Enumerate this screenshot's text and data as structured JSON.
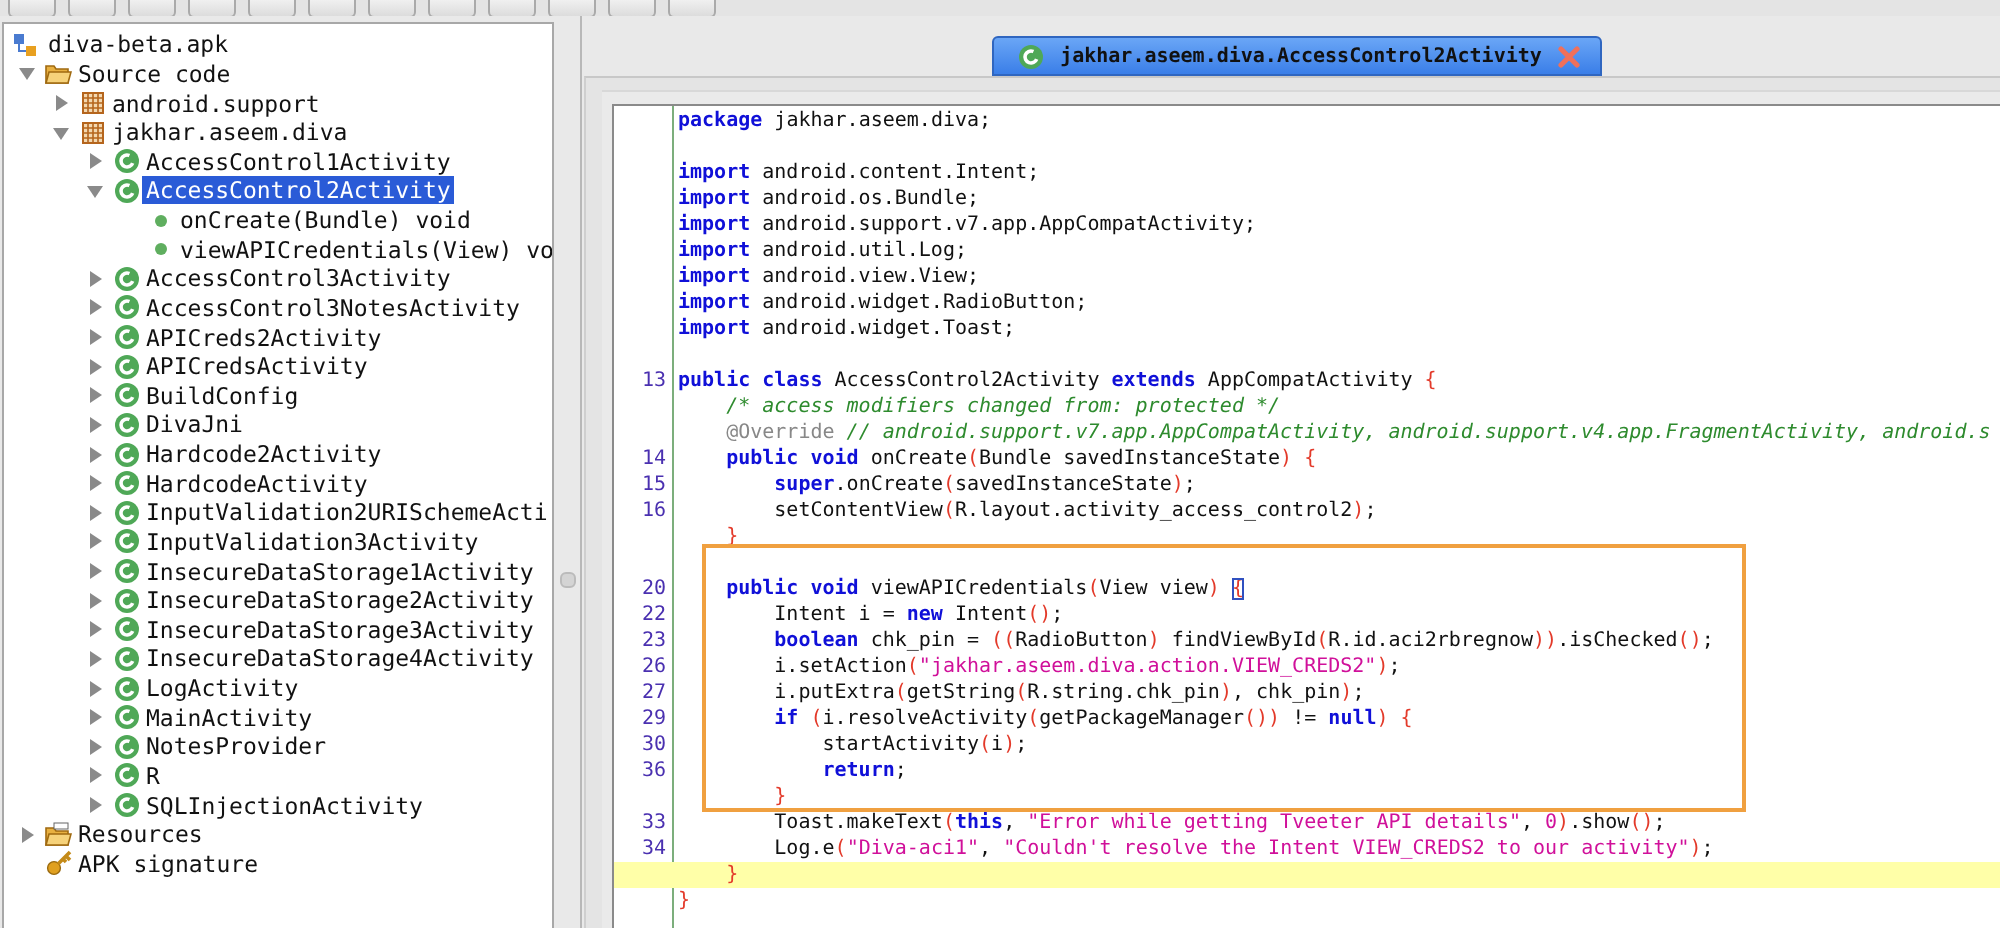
{
  "project": {
    "label": "diva-beta.apk",
    "kind": "apk"
  },
  "tree": [
    {
      "label": "Source code",
      "kind": "folder",
      "expanded": true,
      "selected": false,
      "children": [
        {
          "label": "android.support",
          "kind": "package",
          "expanded": false,
          "selected": false
        },
        {
          "label": "jakhar.aseem.diva",
          "kind": "package",
          "expanded": true,
          "selected": false,
          "children": [
            {
              "label": "AccessControl1Activity",
              "kind": "class",
              "expanded": false,
              "selected": false
            },
            {
              "label": "AccessControl2Activity",
              "kind": "class",
              "expanded": true,
              "selected": true,
              "children": [
                {
                  "label": "onCreate(Bundle) void",
                  "kind": "method",
                  "selected": false
                },
                {
                  "label": "viewAPICredentials(View) vo",
                  "kind": "method",
                  "selected": false
                }
              ]
            },
            {
              "label": "AccessControl3Activity",
              "kind": "class",
              "expanded": false,
              "selected": false
            },
            {
              "label": "AccessControl3NotesActivity",
              "kind": "class",
              "expanded": false,
              "selected": false
            },
            {
              "label": "APICreds2Activity",
              "kind": "class",
              "expanded": false,
              "selected": false
            },
            {
              "label": "APICredsActivity",
              "kind": "class",
              "expanded": false,
              "selected": false
            },
            {
              "label": "BuildConfig",
              "kind": "class",
              "expanded": false,
              "selected": false
            },
            {
              "label": "DivaJni",
              "kind": "class",
              "expanded": false,
              "selected": false
            },
            {
              "label": "Hardcode2Activity",
              "kind": "class",
              "expanded": false,
              "selected": false
            },
            {
              "label": "HardcodeActivity",
              "kind": "class",
              "expanded": false,
              "selected": false
            },
            {
              "label": "InputValidation2URISchemeActi",
              "kind": "class",
              "expanded": false,
              "selected": false
            },
            {
              "label": "InputValidation3Activity",
              "kind": "class",
              "expanded": false,
              "selected": false
            },
            {
              "label": "InsecureDataStorage1Activity",
              "kind": "class",
              "expanded": false,
              "selected": false
            },
            {
              "label": "InsecureDataStorage2Activity",
              "kind": "class",
              "expanded": false,
              "selected": false
            },
            {
              "label": "InsecureDataStorage3Activity",
              "kind": "class",
              "expanded": false,
              "selected": false
            },
            {
              "label": "InsecureDataStorage4Activity",
              "kind": "class",
              "expanded": false,
              "selected": false
            },
            {
              "label": "LogActivity",
              "kind": "class",
              "expanded": false,
              "selected": false
            },
            {
              "label": "MainActivity",
              "kind": "class",
              "expanded": false,
              "selected": false
            },
            {
              "label": "NotesProvider",
              "kind": "class",
              "expanded": false,
              "selected": false
            },
            {
              "label": "R",
              "kind": "class",
              "expanded": false,
              "selected": false
            },
            {
              "label": "SQLInjectionActivity",
              "kind": "class",
              "expanded": false,
              "selected": false
            }
          ]
        }
      ]
    },
    {
      "label": "Resources",
      "kind": "resources",
      "expanded": false,
      "selected": false
    },
    {
      "label": "APK signature",
      "kind": "key",
      "selected": false
    }
  ],
  "editor_tab": {
    "title": "jakhar.aseem.diva.AccessControl2Activity",
    "selected": true
  },
  "code": {
    "lines": [
      {
        "kind": "code",
        "segments": [
          {
            "kind": "keyword",
            "text": "package"
          },
          {
            "kind": "plain",
            "text": " jakhar.aseem.diva;"
          }
        ]
      },
      {
        "kind": "blank"
      },
      {
        "kind": "code",
        "segments": [
          {
            "kind": "keyword",
            "text": "import"
          },
          {
            "kind": "plain",
            "text": " android.content.Intent;"
          }
        ]
      },
      {
        "kind": "code",
        "segments": [
          {
            "kind": "keyword",
            "text": "import"
          },
          {
            "kind": "plain",
            "text": " android.os.Bundle;"
          }
        ]
      },
      {
        "kind": "code",
        "segments": [
          {
            "kind": "keyword",
            "text": "import"
          },
          {
            "kind": "plain",
            "text": " android.support.v7.app.AppCompatActivity;"
          }
        ]
      },
      {
        "kind": "code",
        "segments": [
          {
            "kind": "keyword",
            "text": "import"
          },
          {
            "kind": "plain",
            "text": " android.util.Log;"
          }
        ]
      },
      {
        "kind": "code",
        "segments": [
          {
            "kind": "keyword",
            "text": "import"
          },
          {
            "kind": "plain",
            "text": " android.view.View;"
          }
        ]
      },
      {
        "kind": "code",
        "segments": [
          {
            "kind": "keyword",
            "text": "import"
          },
          {
            "kind": "plain",
            "text": " android.widget.RadioButton;"
          }
        ]
      },
      {
        "kind": "code",
        "segments": [
          {
            "kind": "keyword",
            "text": "import"
          },
          {
            "kind": "plain",
            "text": " android.widget.Toast;"
          }
        ]
      },
      {
        "kind": "blank"
      },
      {
        "kind": "code",
        "number": "13",
        "segments": [
          {
            "kind": "keyword",
            "text": "public class"
          },
          {
            "kind": "plain",
            "text": " AccessControl2Activity "
          },
          {
            "kind": "keyword",
            "text": "extends"
          },
          {
            "kind": "plain",
            "text": " AppCompatActivity "
          },
          {
            "kind": "punct",
            "text": "{"
          }
        ]
      },
      {
        "kind": "code",
        "segments": [
          {
            "kind": "comment",
            "text": "    /* access modifiers changed from: protected */"
          }
        ]
      },
      {
        "kind": "code",
        "segments": [
          {
            "kind": "annotation",
            "text": "    @Override"
          },
          {
            "kind": "comment",
            "text": " // android.support.v7.app.AppCompatActivity, android.support.v4.app.FragmentActivity, android.s"
          }
        ]
      },
      {
        "kind": "code",
        "number": "14",
        "segments": [
          {
            "kind": "keyword",
            "text": "    public void"
          },
          {
            "kind": "plain",
            "text": " onCreate"
          },
          {
            "kind": "punct",
            "text": "("
          },
          {
            "kind": "plain",
            "text": "Bundle savedInstanceState"
          },
          {
            "kind": "punct",
            "text": ") {"
          }
        ]
      },
      {
        "kind": "code",
        "number": "15",
        "segments": [
          {
            "kind": "keyword",
            "text": "        super"
          },
          {
            "kind": "plain",
            "text": ".onCreate"
          },
          {
            "kind": "punct",
            "text": "("
          },
          {
            "kind": "plain",
            "text": "savedInstanceState"
          },
          {
            "kind": "punct",
            "text": ")"
          },
          {
            "kind": "plain",
            "text": ";"
          }
        ]
      },
      {
        "kind": "code",
        "number": "16",
        "segments": [
          {
            "kind": "plain",
            "text": "        setContentView"
          },
          {
            "kind": "punct",
            "text": "("
          },
          {
            "kind": "plain",
            "text": "R.layout.activity_access_control2"
          },
          {
            "kind": "punct",
            "text": ")"
          },
          {
            "kind": "plain",
            "text": ";"
          }
        ]
      },
      {
        "kind": "code",
        "segments": [
          {
            "kind": "punct",
            "text": "    }"
          }
        ]
      },
      {
        "kind": "box",
        "lines": [
          {
            "kind": "blank"
          },
          {
            "kind": "code",
            "number": "20",
            "segments": [
              {
                "kind": "keyword",
                "text": "    public void"
              },
              {
                "kind": "plain",
                "text": " viewAPICredentials"
              },
              {
                "kind": "punct",
                "text": "("
              },
              {
                "kind": "plain",
                "text": "View view"
              },
              {
                "kind": "punct",
                "text": ") "
              },
              {
                "kind": "brace_match",
                "text": "{"
              }
            ]
          },
          {
            "kind": "code",
            "number": "22",
            "segments": [
              {
                "kind": "plain",
                "text": "        Intent i = "
              },
              {
                "kind": "keyword",
                "text": "new"
              },
              {
                "kind": "plain",
                "text": " Intent"
              },
              {
                "kind": "punct",
                "text": "()"
              },
              {
                "kind": "plain",
                "text": ";"
              }
            ]
          },
          {
            "kind": "code",
            "number": "23",
            "segments": [
              {
                "kind": "keyword",
                "text": "        boolean"
              },
              {
                "kind": "plain",
                "text": " chk_pin = "
              },
              {
                "kind": "punct",
                "text": "(("
              },
              {
                "kind": "plain",
                "text": "RadioButton"
              },
              {
                "kind": "punct",
                "text": ")"
              },
              {
                "kind": "plain",
                "text": " findViewById"
              },
              {
                "kind": "punct",
                "text": "("
              },
              {
                "kind": "plain",
                "text": "R.id.aci2rbregnow"
              },
              {
                "kind": "punct",
                "text": "))"
              },
              {
                "kind": "plain",
                "text": ".isChecked"
              },
              {
                "kind": "punct",
                "text": "()"
              },
              {
                "kind": "plain",
                "text": ";"
              }
            ]
          },
          {
            "kind": "code",
            "number": "26",
            "segments": [
              {
                "kind": "plain",
                "text": "        i.setAction"
              },
              {
                "kind": "punct",
                "text": "("
              },
              {
                "kind": "string",
                "text": "\"jakhar.aseem.diva.action.VIEW_CREDS2\""
              },
              {
                "kind": "punct",
                "text": ")"
              },
              {
                "kind": "plain",
                "text": ";"
              }
            ]
          },
          {
            "kind": "code",
            "number": "27",
            "segments": [
              {
                "kind": "plain",
                "text": "        i.putExtra"
              },
              {
                "kind": "punct",
                "text": "("
              },
              {
                "kind": "plain",
                "text": "getString"
              },
              {
                "kind": "punct",
                "text": "("
              },
              {
                "kind": "plain",
                "text": "R.string.chk_pin"
              },
              {
                "kind": "punct",
                "text": ")"
              },
              {
                "kind": "plain",
                "text": ", chk_pin"
              },
              {
                "kind": "punct",
                "text": ")"
              },
              {
                "kind": "plain",
                "text": ";"
              }
            ]
          },
          {
            "kind": "code",
            "number": "29",
            "segments": [
              {
                "kind": "keyword",
                "text": "        if"
              },
              {
                "kind": "punct",
                "text": " ("
              },
              {
                "kind": "plain",
                "text": "i.resolveActivity"
              },
              {
                "kind": "punct",
                "text": "("
              },
              {
                "kind": "plain",
                "text": "getPackageManager"
              },
              {
                "kind": "punct",
                "text": "())"
              },
              {
                "kind": "plain",
                "text": " != "
              },
              {
                "kind": "keyword",
                "text": "null"
              },
              {
                "kind": "punct",
                "text": ") {"
              }
            ]
          },
          {
            "kind": "code",
            "number": "30",
            "segments": [
              {
                "kind": "plain",
                "text": "            startActivity"
              },
              {
                "kind": "punct",
                "text": "("
              },
              {
                "kind": "plain",
                "text": "i"
              },
              {
                "kind": "punct",
                "text": ")"
              },
              {
                "kind": "plain",
                "text": ";"
              }
            ]
          },
          {
            "kind": "code",
            "number": "36",
            "segments": [
              {
                "kind": "keyword",
                "text": "            return"
              },
              {
                "kind": "plain",
                "text": ";"
              }
            ]
          },
          {
            "kind": "code",
            "segments": [
              {
                "kind": "punct",
                "text": "        }"
              }
            ]
          }
        ]
      },
      {
        "kind": "code",
        "number": "33",
        "segments": [
          {
            "kind": "plain",
            "text": "        Toast.makeText"
          },
          {
            "kind": "punct",
            "text": "("
          },
          {
            "kind": "keyword",
            "text": "this"
          },
          {
            "kind": "plain",
            "text": ", "
          },
          {
            "kind": "string",
            "text": "\"Error while getting Tveeter API details\""
          },
          {
            "kind": "plain",
            "text": ", "
          },
          {
            "kind": "string",
            "text": "0"
          },
          {
            "kind": "punct",
            "text": ")"
          },
          {
            "kind": "plain",
            "text": ".show"
          },
          {
            "kind": "punct",
            "text": "()"
          },
          {
            "kind": "plain",
            "text": ";"
          }
        ]
      },
      {
        "kind": "code",
        "number": "34",
        "segments": [
          {
            "kind": "plain",
            "text": "        Log.e"
          },
          {
            "kind": "punct",
            "text": "("
          },
          {
            "kind": "string",
            "text": "\"Diva-aci1\""
          },
          {
            "kind": "plain",
            "text": ", "
          },
          {
            "kind": "string",
            "text": "\"Couldn't resolve the Intent VIEW_CREDS2 to our activity\""
          },
          {
            "kind": "punct",
            "text": ")"
          },
          {
            "kind": "plain",
            "text": ";"
          }
        ]
      },
      {
        "kind": "code",
        "current": true,
        "segments": [
          {
            "kind": "punct",
            "text": "    }"
          }
        ]
      },
      {
        "kind": "code",
        "segments": [
          {
            "kind": "punct",
            "text": "}"
          }
        ]
      }
    ]
  }
}
